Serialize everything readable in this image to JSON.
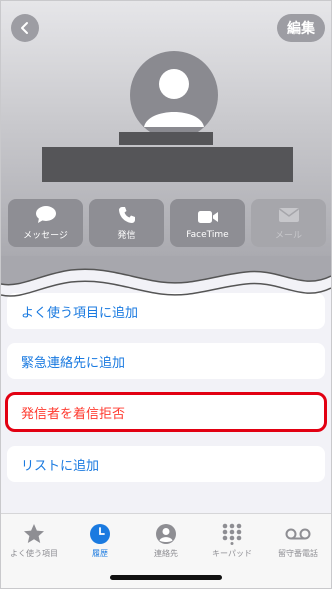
{
  "header": {
    "edit_label": "編集"
  },
  "actions": [
    {
      "label": "メッセージ",
      "icon": "message-icon",
      "enabled": true
    },
    {
      "label": "発信",
      "icon": "phone-icon",
      "enabled": true
    },
    {
      "label": "FaceTime",
      "icon": "video-icon",
      "enabled": true
    },
    {
      "label": "メール",
      "icon": "mail-icon",
      "enabled": false
    }
  ],
  "list": [
    {
      "label": "よく使う項目に追加"
    },
    {
      "label": "緊急連絡先に追加"
    },
    {
      "label": "発信者を着信拒否"
    },
    {
      "label": "リストに追加"
    }
  ],
  "tabs": [
    {
      "label": "よく使う項目",
      "icon": "star-icon",
      "active": false
    },
    {
      "label": "履歴",
      "icon": "clock-icon",
      "active": true
    },
    {
      "label": "連絡先",
      "icon": "contacts-icon",
      "active": false
    },
    {
      "label": "キーパッド",
      "icon": "keypad-icon",
      "active": false
    },
    {
      "label": "留守番電話",
      "icon": "voicemail-icon",
      "active": false
    }
  ],
  "colors": {
    "accent": "#1a7ae0",
    "destructive": "#ff3b30",
    "highlight_outline": "#e20012"
  }
}
